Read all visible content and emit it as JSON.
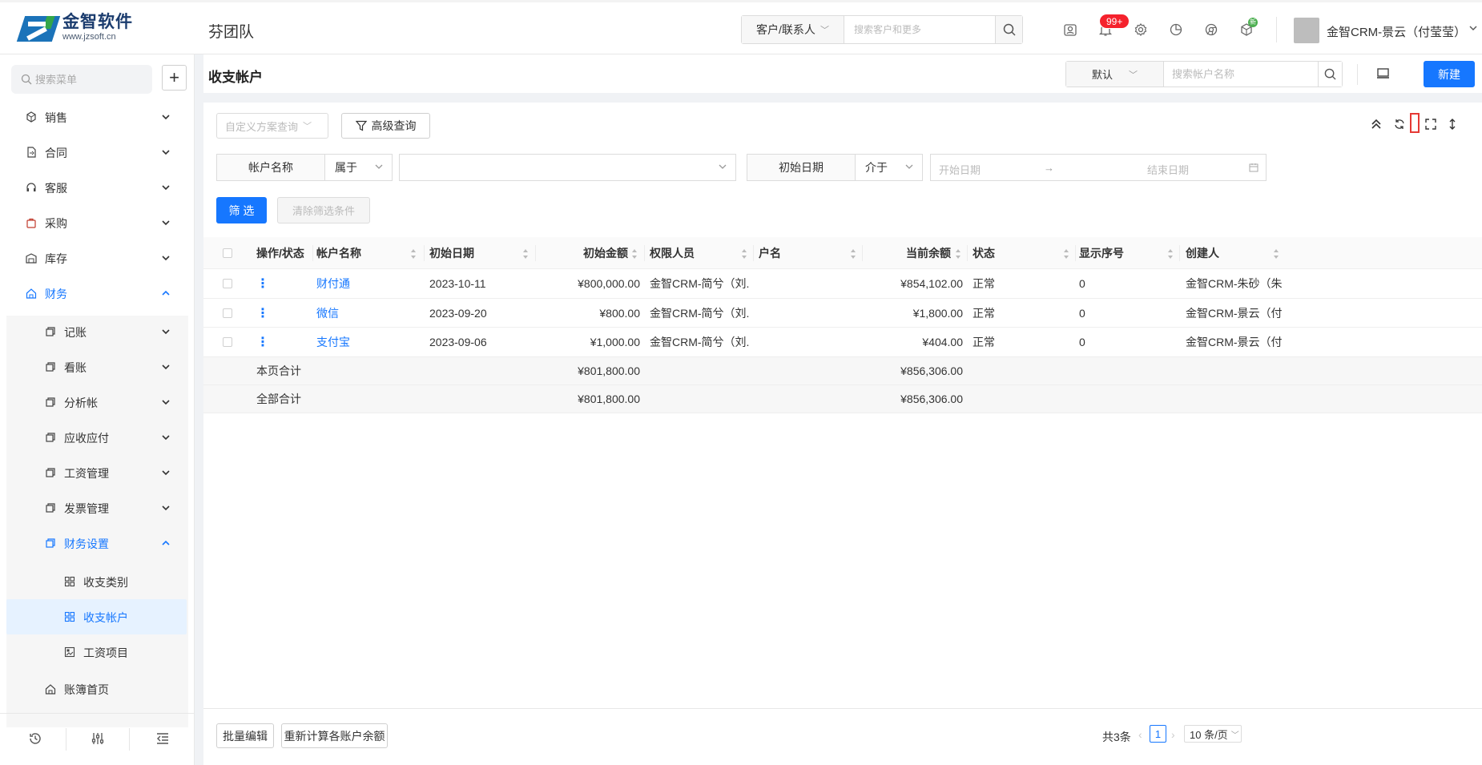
{
  "brand": {
    "name_cn": "金智软件",
    "url": "www.jzsoft.cn",
    "colors": {
      "blue": "#1b73b9",
      "green": "#33a64a"
    }
  },
  "team": "芬团队",
  "global_search": {
    "scope": "客户/联系人",
    "placeholder": "搜索客户和更多"
  },
  "notifications": {
    "badge": "99+"
  },
  "extra_badge": "新",
  "user": {
    "name": "金智CRM-景云（付莹莹）"
  },
  "sidebar": {
    "search_placeholder": "搜索菜单",
    "add": "+",
    "items": [
      {
        "label": "销售",
        "icon": "cube-icon"
      },
      {
        "label": "合同",
        "icon": "document-icon"
      },
      {
        "label": "客服",
        "icon": "headset-icon"
      },
      {
        "label": "采购",
        "icon": "bag-icon"
      },
      {
        "label": "库存",
        "icon": "warehouse-icon"
      },
      {
        "label": "财务",
        "icon": "home-icon"
      }
    ],
    "finance_sub": [
      {
        "label": "记账"
      },
      {
        "label": "看账"
      },
      {
        "label": "分析帐"
      },
      {
        "label": "应收应付"
      },
      {
        "label": "工资管理"
      },
      {
        "label": "发票管理"
      },
      {
        "label": "财务设置"
      }
    ],
    "settings_sub": [
      {
        "label": "收支类别"
      },
      {
        "label": "收支帐户"
      },
      {
        "label": "工资项目"
      }
    ],
    "home_item": "账簿首页"
  },
  "header": {
    "title": "收支帐户",
    "view": "默认",
    "search_placeholder": "搜索帐户名称",
    "new": "新建"
  },
  "filters": {
    "scheme_placeholder": "自定义方案查询",
    "advanced": "高级查询",
    "f1_label": "帐户名称",
    "f1_op": "属于",
    "f2_label": "初始日期",
    "f2_op": "介于",
    "start_placeholder": "开始日期",
    "arrow": "→",
    "end_placeholder": "结束日期",
    "apply": "筛 选",
    "clear": "清除筛选条件"
  },
  "table": {
    "headers": [
      "操作/状态",
      "帐户名称",
      "初始日期",
      "初始金额",
      "权限人员",
      "户名",
      "当前余额",
      "状态",
      "显示序号",
      "创建人"
    ],
    "rows": [
      {
        "name": "财付通",
        "date": "2023-10-11",
        "init": "¥800,000.00",
        "perm": "金智CRM-简兮（刘...",
        "holder": "",
        "balance": "¥854,102.00",
        "status": "正常",
        "order": "0",
        "creator": "金智CRM-朱砂（朱..."
      },
      {
        "name": "微信",
        "date": "2023-09-20",
        "init": "¥800.00",
        "perm": "金智CRM-简兮（刘...",
        "holder": "",
        "balance": "¥1,800.00",
        "status": "正常",
        "order": "0",
        "creator": "金智CRM-景云（付..."
      },
      {
        "name": "支付宝",
        "date": "2023-09-06",
        "init": "¥1,000.00",
        "perm": "金智CRM-简兮（刘...",
        "holder": "",
        "balance": "¥404.00",
        "status": "正常",
        "order": "0",
        "creator": "金智CRM-景云（付..."
      }
    ],
    "page_total": {
      "label": "本页合计",
      "init": "¥801,800.00",
      "balance": "¥856,306.00"
    },
    "grand_total": {
      "label": "全部合计",
      "init": "¥801,800.00",
      "balance": "¥856,306.00"
    }
  },
  "footer": {
    "batch_edit": "批量编辑",
    "recalc": "重新计算各账户余额",
    "total": "共3条",
    "page": "1",
    "page_size": "10 条/页"
  }
}
